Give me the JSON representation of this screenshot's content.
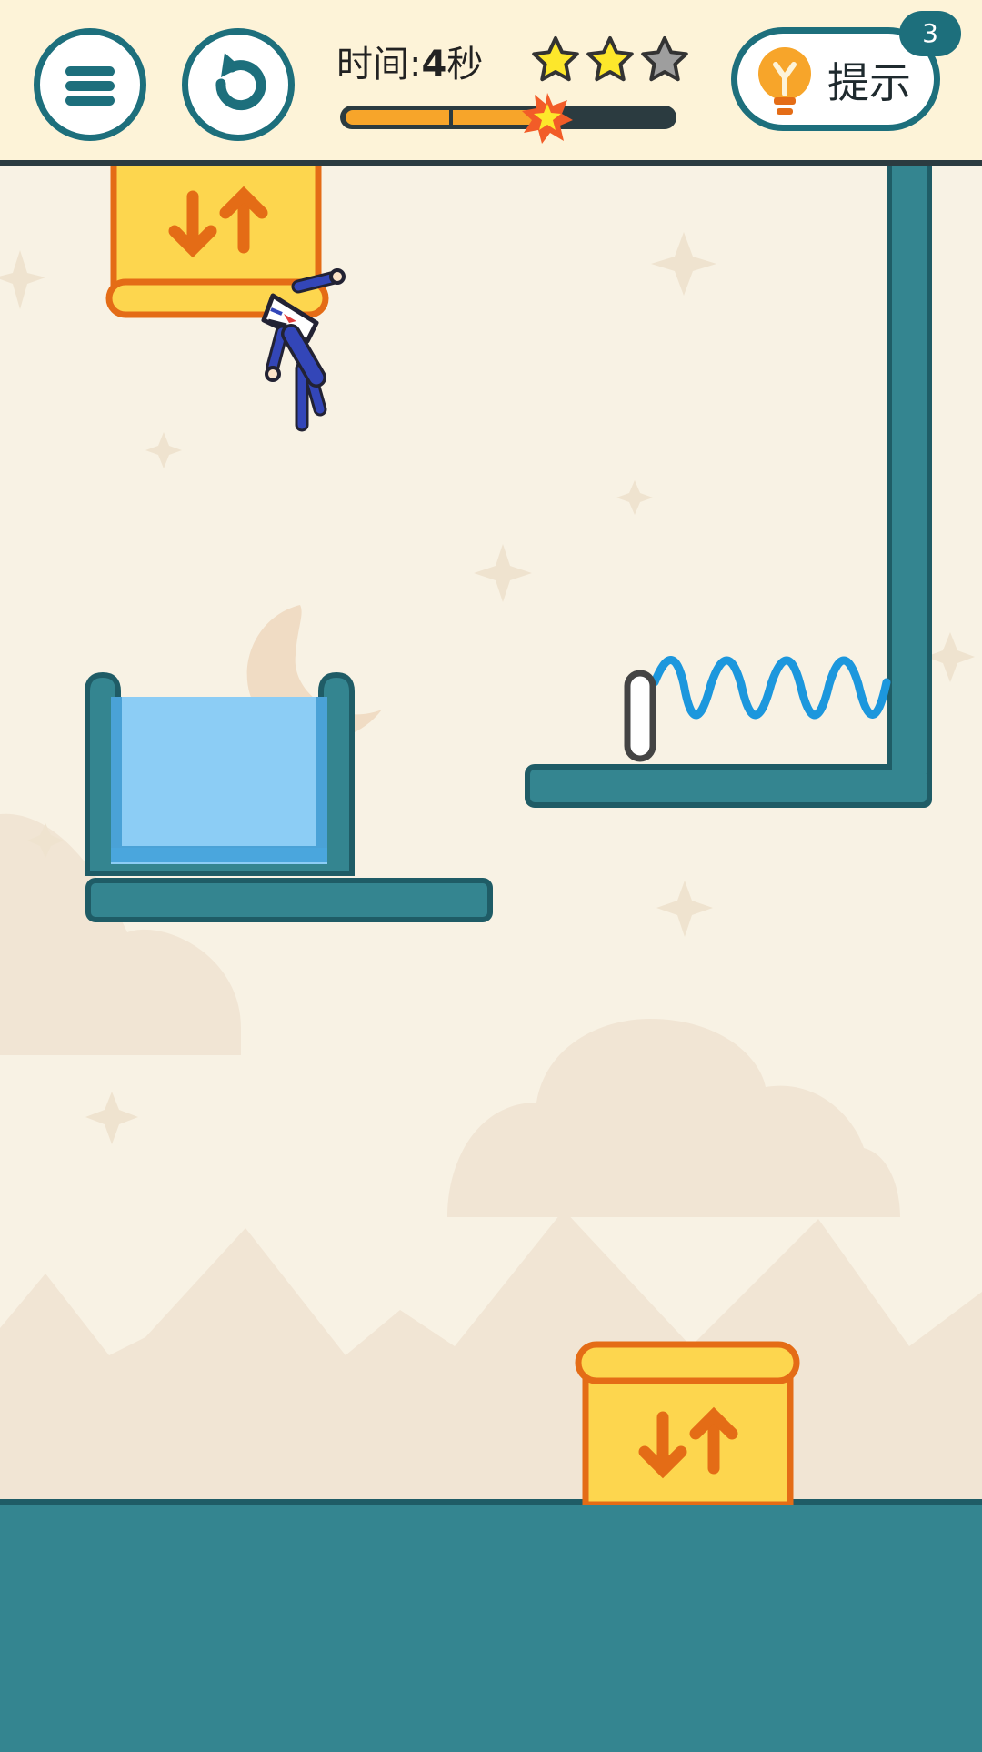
{
  "hud": {
    "menu_icon": "hamburger-menu-icon",
    "restart_icon": "restart-arrow-icon",
    "time_label": "时间:",
    "time_value": "4",
    "time_unit": "秒",
    "star_rating": {
      "earned": 2,
      "total": 3
    },
    "time_progress": 0.6,
    "hint": {
      "label": "提示",
      "icon": "lightbulb-icon",
      "count": "3"
    }
  },
  "level": {
    "portal_icon": "swap-up-down-arrows-icon",
    "spring_icon": "coil-spring",
    "colors": {
      "accent": "#1d6f7c",
      "wall": "#348590",
      "wall_outline": "#1f5c66",
      "portal": "#fdd64e",
      "portal_outline": "#e46c16",
      "water": "#8ccdf5",
      "spring": "#1c97dd",
      "star_on": "#fde72b",
      "star_off": "#9e9e9e",
      "progress": "#f7a52a",
      "background": "#f8f2e4"
    }
  }
}
